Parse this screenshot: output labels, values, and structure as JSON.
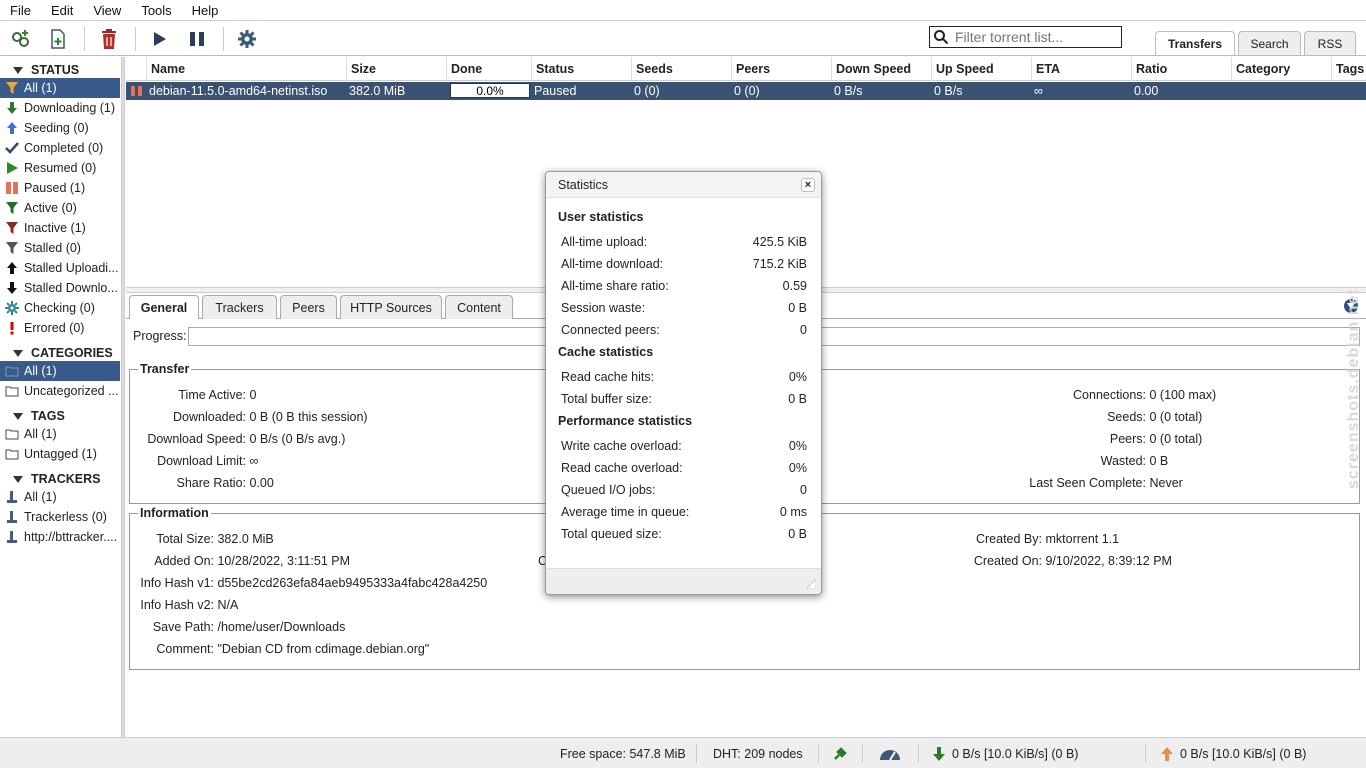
{
  "menu": [
    "File",
    "Edit",
    "View",
    "Tools",
    "Help"
  ],
  "toolbar": {
    "filter_placeholder": "Filter torrent list...",
    "tabs": [
      "Transfers",
      "Search",
      "RSS"
    ]
  },
  "sidebar": {
    "status_title": "STATUS",
    "status_items": [
      "All (1)",
      "Downloading (1)",
      "Seeding (0)",
      "Completed (0)",
      "Resumed (0)",
      "Paused (1)",
      "Active (0)",
      "Inactive (1)",
      "Stalled (0)",
      "Stalled Uploadi...",
      "Stalled Downlo...",
      "Checking (0)",
      "Errored (0)"
    ],
    "categories_title": "CATEGORIES",
    "categories_items": [
      "All (1)",
      "Uncategorized ..."
    ],
    "tags_title": "TAGS",
    "tags_items": [
      "All (1)",
      "Untagged (1)"
    ],
    "trackers_title": "TRACKERS",
    "trackers_items": [
      "All (1)",
      "Trackerless (0)",
      "http://bttracker...."
    ]
  },
  "table": {
    "headers": [
      "Name",
      "Size",
      "Done",
      "Status",
      "Seeds",
      "Peers",
      "Down Speed",
      "Up Speed",
      "ETA",
      "Ratio",
      "Category",
      "Tags"
    ],
    "row": {
      "name": "debian-11.5.0-amd64-netinst.iso",
      "size": "382.0 MiB",
      "done": "0.0%",
      "status": "Paused",
      "seeds": "0 (0)",
      "peers": "0 (0)",
      "down_speed": "0 B/s",
      "up_speed": "0 B/s",
      "eta": "∞",
      "ratio": "0.00"
    }
  },
  "details": {
    "tabs": [
      "General",
      "Trackers",
      "Peers",
      "HTTP Sources",
      "Content"
    ],
    "progress_label": "Progress:",
    "transfer_title": "Transfer",
    "transfer": [
      {
        "k": "Time Active:",
        "v": "0"
      },
      {
        "k": "Downloaded:",
        "v": "0 B (0 B this session)"
      },
      {
        "k": "Download Speed:",
        "v": "0 B/s (0 B/s avg.)"
      },
      {
        "k": "Download Limit:",
        "v": "∞"
      },
      {
        "k": "Share Ratio:",
        "v": "0.00"
      }
    ],
    "transfer_right": [
      {
        "k": "Connections:",
        "v": "0 (100 max)"
      },
      {
        "k": "Seeds:",
        "v": "0 (0 total)"
      },
      {
        "k": "Peers:",
        "v": "0 (0 total)"
      },
      {
        "k": "Wasted:",
        "v": "0 B"
      },
      {
        "k": "Last Seen Complete:",
        "v": "Never"
      }
    ],
    "info_title": "Information",
    "info": [
      {
        "k": "Total Size:",
        "v": "382.0 MiB"
      },
      {
        "k": "Added On:",
        "v": "10/28/2022, 3:11:51 PM"
      },
      {
        "k": "Info Hash v1:",
        "v": "d55be2cd263efa84aeb9495333a4fabc428a4250"
      },
      {
        "k": "Info Hash v2:",
        "v": "N/A"
      },
      {
        "k": "Save Path:",
        "v": "/home/user/Downloads"
      },
      {
        "k": "Comment:",
        "v": "\"Debian CD from cdimage.debian.org\""
      }
    ],
    "info_partial": "C",
    "info_right": [
      {
        "k": "Created By:",
        "v": "mktorrent 1.1"
      },
      {
        "k": "Created On:",
        "v": "9/10/2022, 8:39:12 PM"
      }
    ]
  },
  "statusbar": {
    "free_space": "Free space: 547.8 MiB",
    "dht": "DHT: 209 nodes",
    "down": "0 B/s [10.0 KiB/s] (0 B)",
    "up": "0 B/s [10.0 KiB/s] (0 B)"
  },
  "statistics": {
    "title": "Statistics",
    "user_title": "User statistics",
    "user": [
      {
        "k": "All-time upload:",
        "v": "425.5 KiB"
      },
      {
        "k": "All-time download:",
        "v": "715.2 KiB"
      },
      {
        "k": "All-time share ratio:",
        "v": "0.59"
      },
      {
        "k": "Session waste:",
        "v": "0 B"
      },
      {
        "k": "Connected peers:",
        "v": "0"
      }
    ],
    "cache_title": "Cache statistics",
    "cache": [
      {
        "k": "Read cache hits:",
        "v": "0%"
      },
      {
        "k": "Total buffer size:",
        "v": "0 B"
      }
    ],
    "perf_title": "Performance statistics",
    "perf": [
      {
        "k": "Write cache overload:",
        "v": "0%"
      },
      {
        "k": "Read cache overload:",
        "v": "0%"
      },
      {
        "k": "Queued I/O jobs:",
        "v": "0"
      },
      {
        "k": "Average time in queue:",
        "v": "0 ms"
      },
      {
        "k": "Total queued size:",
        "v": "0 B"
      }
    ]
  },
  "watermark": "screenshots.debian.net",
  "colors": {
    "selection": "#3a5a8c",
    "row_selected": "#3a5272",
    "paused": "#e8705a",
    "downloading": "#2a7a2a",
    "seeding": "#3a6fd8",
    "errored": "#e00000"
  }
}
